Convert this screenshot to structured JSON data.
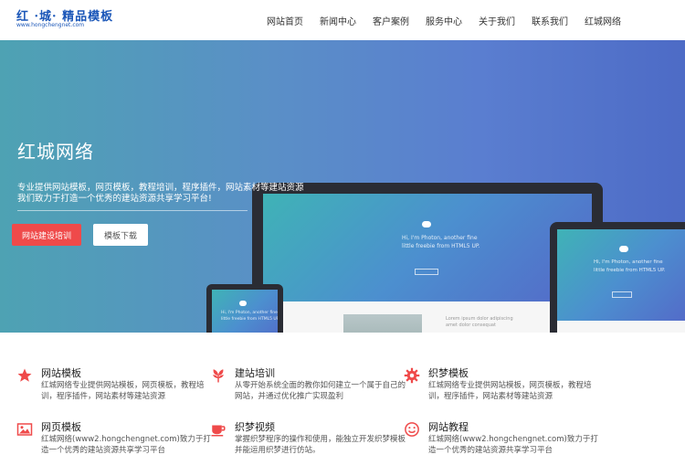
{
  "header": {
    "logo_main": "红 ·城· 精品模板",
    "logo_sub": "www.hongchengnet.com",
    "nav": [
      "网站首页",
      "新闻中心",
      "客户案例",
      "服务中心",
      "关于我们",
      "联系我们",
      "红城网络"
    ]
  },
  "hero": {
    "title": "红城网络",
    "line1": "专业提供网站模板，网页模板，教程培训，程序插件，网站素材等建站资源",
    "line2": "我们致力于打造一个优秀的建站资源共享学习平台!",
    "btn_primary": "网站建设培训",
    "btn_secondary": "模板下载",
    "mock_main_text": "Hi, I'm Photon, another fine\nlittle freebie from HTML5 UP.",
    "mock_side_text": "Hi, I'm Photon, another fine\nlittle freebie from HTML5 UP.",
    "mock_lorem": "Lorem ipsum dolor adipiscing\namet dolor consequat"
  },
  "features": [
    {
      "title": "网站模板",
      "desc": "红城网络专业提供网站模板，网页模板，教程培训，程序插件，网站素材等建站资源",
      "icon": "star-icon",
      "color": "#ef4a4a"
    },
    {
      "title": "建站培训",
      "desc": "从零开始系统全面的教你如何建立一个属于自己的网站，并通过优化推广实现盈利",
      "icon": "flower-icon",
      "color": "#ef4a4a"
    },
    {
      "title": "织梦模板",
      "desc": "红城网络专业提供网站模板，网页模板，教程培训，程序插件，网站素材等建站资源",
      "icon": "gear-icon",
      "color": "#ef4a4a"
    },
    {
      "title": "网页模板",
      "desc": "红城网络(www2.hongchengnet.com)致力于打造一个优秀的建站资源共享学习平台",
      "icon": "image-icon",
      "color": "#ef4a4a"
    },
    {
      "title": "织梦视频",
      "desc": "掌握织梦程序的操作和使用，能独立开发织梦模板并能运用织梦进行仿站。",
      "icon": "coffee-cup-icon",
      "color": "#ef4a4a"
    },
    {
      "title": "网站教程",
      "desc": "红城网络(www2.hongchengnet.com)致力于打造一个优秀的建站资源共享学习平台",
      "icon": "smiley-icon",
      "color": "#ef4a4a"
    }
  ]
}
